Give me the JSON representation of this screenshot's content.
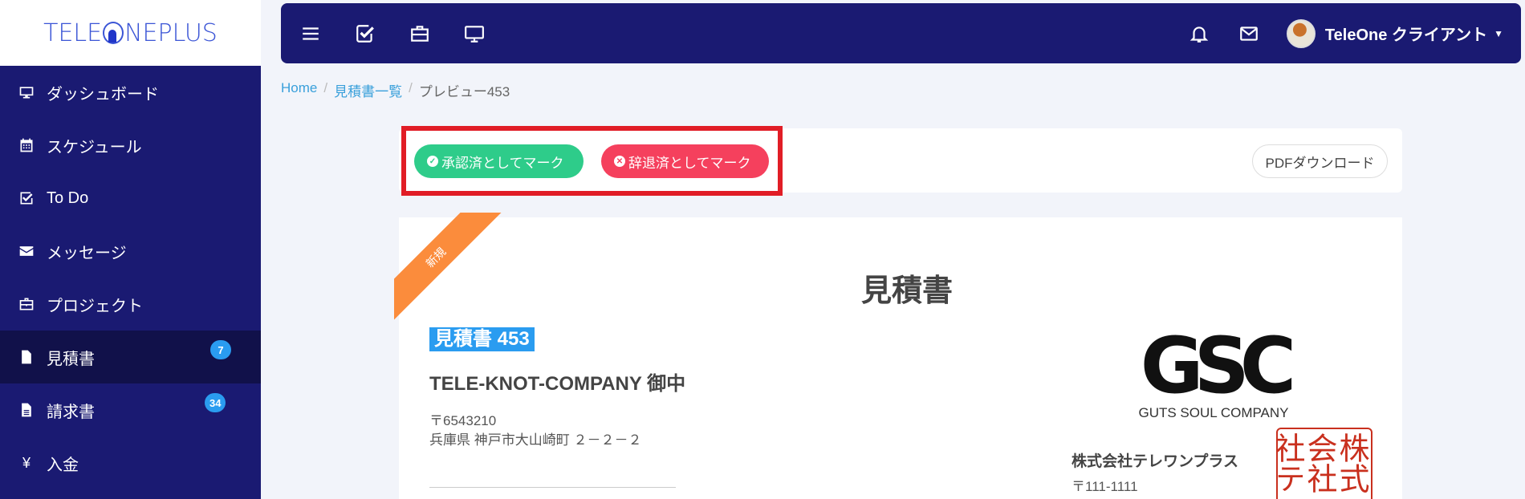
{
  "app": {
    "logo_text_left": "TELE",
    "logo_text_right": "NEPLUS"
  },
  "sidebar": {
    "items": [
      {
        "label": "ダッシュボード",
        "icon": "monitor-icon"
      },
      {
        "label": "スケジュール",
        "icon": "calendar-icon"
      },
      {
        "label": "To Do",
        "icon": "checkbox-icon"
      },
      {
        "label": "メッセージ",
        "icon": "envelope-icon"
      },
      {
        "label": "プロジェクト",
        "icon": "briefcase-icon"
      },
      {
        "label": "見積書",
        "icon": "file-icon",
        "badge": "7",
        "active": true
      },
      {
        "label": "請求書",
        "icon": "file-text-icon",
        "badge": "34"
      },
      {
        "label": "入金",
        "icon": "yen-icon",
        "glyph": "¥"
      }
    ]
  },
  "topbar": {
    "username": "TeleOne クライアント",
    "icons": [
      "menu-icon",
      "check-square-icon",
      "briefcase-icon",
      "monitor-icon",
      "bell-icon",
      "envelope-icon"
    ]
  },
  "breadcrumb": {
    "home": "Home",
    "list": "見積書一覧",
    "current": "プレビュー453",
    "separator": "/"
  },
  "actions": {
    "approve_label": "承認済としてマーク",
    "decline_label": "辞退済としてマーク",
    "pdf_label": "PDFダウンロード",
    "approve_color": "#2ecc8a",
    "decline_color": "#f5405d",
    "highlight_color": "#e11d26"
  },
  "document": {
    "ribbon": "新規",
    "title": "見積書",
    "quote_label": "見積書 453",
    "client": {
      "name": "TELE-KNOT-COMPANY 御中",
      "zip": "〒6543210",
      "address": "兵庫県 神戸市大山崎町 ２－２－２"
    },
    "company": {
      "logo_mark": "GSC",
      "logo_sub": "GUTS SOUL COMPANY",
      "name": "株式会社テレワンプラス",
      "zip": "〒111-1111",
      "seal_text": "株式会社社テスト"
    }
  }
}
